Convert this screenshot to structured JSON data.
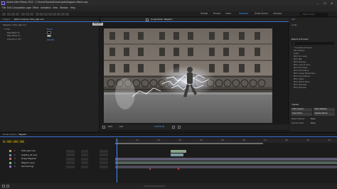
{
  "app": {
    "title": "Adobe After Effects 2022 - C:\\Users\\Sandra\\Downloads\\Magazin effects.aep",
    "window_controls": [
      "–",
      "☐",
      "✕"
    ]
  },
  "menu": [
    "File",
    "Edit",
    "Composition",
    "Layer",
    "Effect",
    "Animation",
    "View",
    "Window",
    "Help"
  ],
  "toolbar": {
    "workspaces": [
      "Default",
      "Review",
      "Learn",
      "Standard",
      "Small Screen",
      "Libraries"
    ],
    "active_workspace": "Standard",
    "search_placeholder": "Search Help"
  },
  "left_panel": {
    "tabs": [
      "Project",
      "Effect Controls: Tebe_ligh.mov"
    ],
    "rows": [
      "Magazin • Tebe_ligh.mov",
      "fx  Tint",
      "Map Black To",
      "Map White To",
      "Amount to Tint"
    ],
    "value": "Reset"
  },
  "viewer": {
    "tab": "Composition: Magazin",
    "comp_name": "Magazin",
    "zoom": "50%",
    "bottom_items": [
      "50%",
      "Full",
      "0:00:00:00"
    ]
  },
  "right_panel": {
    "top_items": [
      "Info",
      "Audio"
    ],
    "effects_title": "Effects & Presets",
    "search_placeholder": "P-",
    "categories": [
      "* Animation Presets",
      "3D Channel",
      "Audio",
      "BCC Art Looks",
      "BCC Blur",
      "BCC Browser",
      "BCC Color & Tone",
      "BCC Film Style",
      "BCC Generators",
      "BCC Image Restoration",
      "BCC Key & Blend",
      "BCC Lights",
      "BCC Match Move",
      "BCC Obsolete",
      "BCC Particles"
    ],
    "tracker_title": "Tracker",
    "tracker_buttons": [
      "Track Camera",
      "Warp Stabilizer",
      "Track Motion",
      "Stabilize Motion"
    ],
    "motion_source_label": "Motion Source:",
    "motion_source_value": "None",
    "current_track_label": "Current Track:",
    "current_track_value": "None"
  },
  "timeline": {
    "tabs": [
      "Render Queue",
      "Magazin"
    ],
    "timecode": "0:00:00:00",
    "layers": [
      {
        "num": "1",
        "name": "[Tebe_ligh.mov]",
        "color": "#c9a06c"
      },
      {
        "num": "2",
        "name": "[Lighting_02.mov]",
        "color": "#6c8ac9"
      },
      {
        "num": "3",
        "name": "[Image Magazin]",
        "color": "#c96c6c"
      },
      {
        "num": "4",
        "name": "[Magazin.mp4]",
        "color": "#6cc98a"
      },
      {
        "num": "5",
        "name": "[Girl Running]",
        "color": "#9a6cc9"
      }
    ],
    "ruler": [
      "0s",
      "01s",
      "02s",
      "03s",
      "04s",
      "05s",
      "06s",
      "07s",
      "08s",
      "09s",
      "10s"
    ]
  },
  "colors": {
    "accent": "#3d8eff",
    "timecode": "#e8c400",
    "work_area": "#6d6d6d"
  }
}
